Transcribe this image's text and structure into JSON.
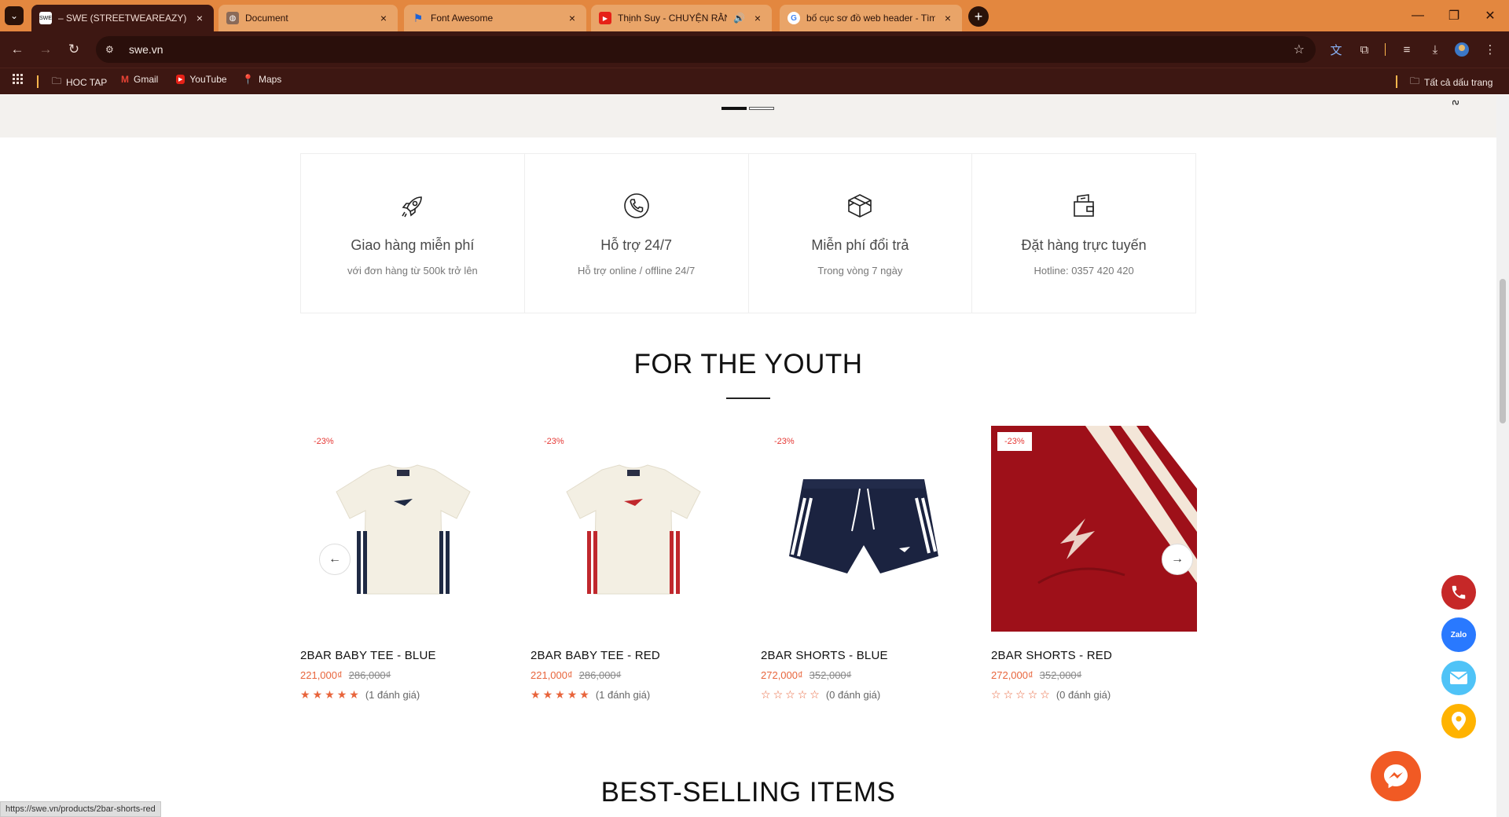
{
  "browser": {
    "tabs": [
      {
        "title": "– SWE (STREETWEAREAZY)",
        "favicon": "swe-logo-icon",
        "active": true
      },
      {
        "title": "Document",
        "favicon": "globe-icon",
        "active": false
      },
      {
        "title": "Font Awesome",
        "favicon": "font-awesome-flag-icon",
        "active": false
      },
      {
        "title": "Thịnh Suy - CHUYỆN RẰNG",
        "favicon": "youtube-icon",
        "active": false,
        "audio": true
      },
      {
        "title": "bố cục sơ đồ web header - Tìm",
        "favicon": "google-icon",
        "active": false
      }
    ],
    "address": "swe.vn",
    "bookmarks": [
      {
        "label": "HOC TAP",
        "icon": "folder-icon"
      },
      {
        "label": "Gmail",
        "icon": "gmail-icon"
      },
      {
        "label": "YouTube",
        "icon": "youtube-icon"
      },
      {
        "label": "Maps",
        "icon": "maps-pin-icon"
      }
    ],
    "all_bookmarks": "Tất cả dấu trang",
    "status_url": "https://swe.vn/products/2bar-shorts-red"
  },
  "features": [
    {
      "icon": "rocket-icon",
      "title": "Giao hàng miễn phí",
      "subtitle": "với đơn hàng từ 500k trở lên"
    },
    {
      "icon": "phone-icon",
      "title": "Hỗ trợ 24/7",
      "subtitle": "Hỗ trợ online / offline 24/7"
    },
    {
      "icon": "box-icon",
      "title": "Miễn phí đổi trả",
      "subtitle": "Trong vòng 7 ngày"
    },
    {
      "icon": "wallet-icon",
      "title": "Đặt hàng trực tuyến",
      "subtitle": "Hotline: 0357 420 420"
    }
  ],
  "sections": {
    "youth_title": "FOR THE YOUTH",
    "bestselling_title": "BEST-SELLING ITEMS"
  },
  "products": [
    {
      "name": "2BAR BABY TEE - BLUE",
      "price": "221,000₫",
      "old_price": "286,000₫",
      "discount": "-23%",
      "rating": 5,
      "reviews": "(1 đánh giá)",
      "stripe_color": "#1f2a44"
    },
    {
      "name": "2BAR BABY TEE - RED",
      "price": "221,000₫",
      "old_price": "286,000₫",
      "discount": "-23%",
      "rating": 5,
      "reviews": "(1 đánh giá)",
      "stripe_color": "#c0282d"
    },
    {
      "name": "2BAR SHORTS - BLUE",
      "price": "272,000₫",
      "old_price": "352,000₫",
      "discount": "-23%",
      "rating": 0,
      "reviews": "(0 đánh giá)",
      "stripe_color": "#ffffff"
    },
    {
      "name": "2BAR SHORTS - RED",
      "price": "272,000₫",
      "old_price": "352,000₫",
      "discount": "-23%",
      "rating": 0,
      "reviews": "(0 đánh giá)",
      "stripe_color": "#f3e6d8"
    }
  ],
  "contact_buttons": [
    {
      "icon": "phone-icon",
      "color": "#c62828"
    },
    {
      "icon": "zalo-icon",
      "color": "#2979ff",
      "label": "Zalo"
    },
    {
      "icon": "mail-icon",
      "color": "#4fc3f7"
    },
    {
      "icon": "location-pin-icon",
      "color": "#ffb300"
    }
  ],
  "colors": {
    "accent": "#e8643b",
    "tabbar": "#e3873f",
    "toolbar": "#3d1712"
  }
}
